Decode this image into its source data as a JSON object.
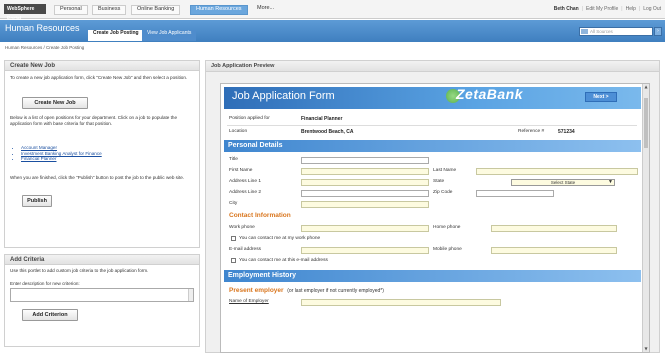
{
  "topbar": {
    "logo": "WebSphere Portal",
    "tabs": [
      "Personal",
      "Business",
      "Online Banking",
      "Human Resources",
      "More..."
    ],
    "active_tab": 3,
    "user": "Beth Chan",
    "links": [
      "Edit My Profile",
      "Help",
      "Log Out"
    ]
  },
  "section": {
    "title": "Human Resources",
    "tabs": [
      "Create Job Posting",
      "View Job Applicants"
    ],
    "search_placeholder": "All Sources"
  },
  "breadcrumb": "Human Resources  /  Create Job Posting",
  "create_job": {
    "heading": "Create New Job",
    "intro": "To create a new job application form, click \"Create New Job\" and then select a position.",
    "button": "Create New Job",
    "list_intro": "Below is a list of open positions for your department. Click on a job to populate the application form with base criteria for that position.",
    "jobs": [
      "Account Manager",
      "Investment Banking Analyst for Finance",
      "Financial Planner"
    ],
    "publish_text": "When you are finished, click the \"Publish\" button to post the job to the public web site.",
    "publish_button": "Publish"
  },
  "add_criteria": {
    "heading": "Add Criteria",
    "intro": "Use this portlet to add custom job criteria to the job application form.",
    "field_label": "Enter description for new criterion:",
    "button": "Add Criterion"
  },
  "preview": {
    "heading": "Job Application Preview",
    "form_title": "Job Application Form",
    "brand": "ZetaBank",
    "next_label": "Next >",
    "position_label": "Position applied for",
    "position_value": "Financial Planner",
    "location_label": "Location",
    "location_value": "Brentwood Beach, CA",
    "reference_label": "Reference #",
    "reference_value": "571234",
    "personal_details": "Personal Details",
    "fields": {
      "title": "Title",
      "first_name": "First Name",
      "last_name": "Last Name",
      "address1": "Address Line 1",
      "address2": "Address Line 2",
      "state": "State",
      "state_select": "Select State",
      "zip": "Zip Code",
      "city": "City"
    },
    "contact_info": "Contact Information",
    "contact": {
      "work_phone": "Work phone",
      "home_phone": "Home phone",
      "work_ok": "You can contact me at my work phone",
      "email": "E-mail address",
      "mobile": "Mobile phone",
      "email_ok": "You can contact me at this e-mail address"
    },
    "employment_history": "Employment History",
    "present_employer": "Present employer",
    "present_employer_note": "(or last employer if not currently employed*)",
    "employer_name": "Name of Employer"
  }
}
